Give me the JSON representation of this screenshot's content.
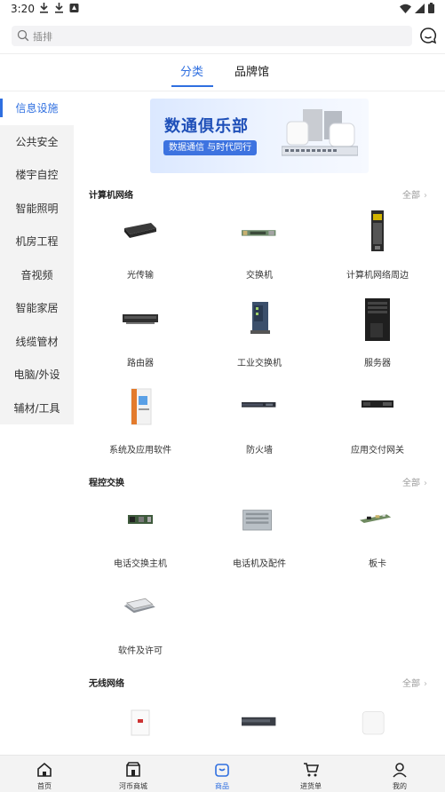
{
  "status_bar": {
    "time": "3:20",
    "left_icons": [
      "download-icon",
      "download-icon",
      "app-notification-icon"
    ],
    "right_icons": [
      "wifi-icon",
      "signal-icon",
      "battery-icon"
    ]
  },
  "search": {
    "placeholder": "插排",
    "chat_icon": "chat-icon"
  },
  "tabs": [
    {
      "label": "分类",
      "active": true
    },
    {
      "label": "品牌馆",
      "active": false
    }
  ],
  "sidebar": {
    "items": [
      {
        "label": "信息设施",
        "active": true
      },
      {
        "label": "公共安全"
      },
      {
        "label": "楼宇自控"
      },
      {
        "label": "智能照明"
      },
      {
        "label": "机房工程"
      },
      {
        "label": "音视频"
      },
      {
        "label": "智能家居"
      },
      {
        "label": "线缆管材"
      },
      {
        "label": "电脑/外设"
      },
      {
        "label": "辅材/工具"
      }
    ]
  },
  "banner": {
    "title": "数通俱乐部",
    "subtitle": "数据通信  与时代同行"
  },
  "sections": [
    {
      "title": "计算机网络",
      "all_label": "全部",
      "items": [
        {
          "label": "光传输",
          "icon": "optical-transmitter-icon"
        },
        {
          "label": "交换机",
          "icon": "switch-board-icon"
        },
        {
          "label": "计算机网络周边",
          "icon": "power-module-icon"
        },
        {
          "label": "路由器",
          "icon": "router-icon"
        },
        {
          "label": "工业交换机",
          "icon": "industrial-switch-icon"
        },
        {
          "label": "服务器",
          "icon": "server-tower-icon"
        },
        {
          "label": "系统及应用软件",
          "icon": "software-box-icon"
        },
        {
          "label": "防火墙",
          "icon": "firewall-icon"
        },
        {
          "label": "应用交付网关",
          "icon": "gateway-icon"
        }
      ]
    },
    {
      "title": "程控交换",
      "all_label": "全部",
      "items": [
        {
          "label": "电话交换主机",
          "icon": "pbx-board-icon"
        },
        {
          "label": "电话机及配件",
          "icon": "pbx-chassis-icon"
        },
        {
          "label": "板卡",
          "icon": "circuit-card-icon"
        },
        {
          "label": "软件及许可",
          "icon": "license-cards-icon"
        }
      ]
    },
    {
      "title": "无线网络",
      "all_label": "全部",
      "items": [
        {
          "label": "",
          "icon": "wall-ap-icon"
        },
        {
          "label": "",
          "icon": "wireless-controller-icon"
        },
        {
          "label": "",
          "icon": "ceiling-ap-icon"
        }
      ]
    }
  ],
  "bottom_nav": [
    {
      "label": "首页",
      "icon": "home-icon"
    },
    {
      "label": "河币商城",
      "icon": "store-icon"
    },
    {
      "label": "商品",
      "icon": "products-icon",
      "active": true
    },
    {
      "label": "进货单",
      "icon": "cart-icon"
    },
    {
      "label": "我的",
      "icon": "profile-icon"
    }
  ],
  "colors": {
    "accent": "#2f6fe0",
    "sidebar_bg": "#f3f3f3"
  }
}
